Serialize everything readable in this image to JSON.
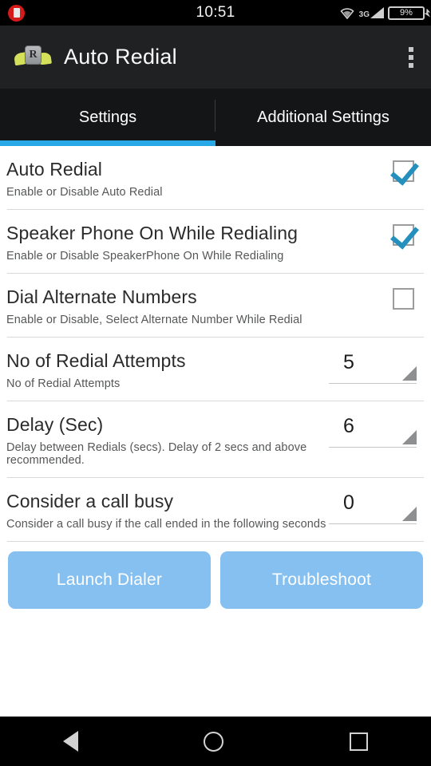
{
  "statusbar": {
    "sim_icon": "sim-card-icon",
    "clock": "10:51",
    "wifi_icon": "wifi-icon",
    "network_label": "3G",
    "signal_icon": "signal-bars-icon",
    "battery_text": "9%",
    "battery_charging_icon": "charging-bolt-icon"
  },
  "actionbar": {
    "app_icon": "auto-redial-app-icon",
    "app_icon_letter": "R",
    "title": "Auto Redial",
    "overflow_icon": "overflow-menu-icon"
  },
  "tabs": [
    {
      "label": "Settings",
      "active": true
    },
    {
      "label": "Additional Settings",
      "active": false
    }
  ],
  "settings": {
    "rows": [
      {
        "title": "Auto Redial",
        "subtitle": "Enable or Disable Auto Redial",
        "control": "checkbox",
        "checked": true
      },
      {
        "title": "Speaker Phone On While Redialing",
        "subtitle": "Enable or Disable SpeakerPhone On While Redialing",
        "control": "checkbox",
        "checked": true
      },
      {
        "title": "Dial Alternate Numbers",
        "subtitle": "Enable or Disable, Select Alternate Number While Redial",
        "control": "checkbox",
        "checked": false
      },
      {
        "title": "No of Redial Attempts",
        "subtitle": "No of Redial Attempts",
        "control": "spinner",
        "value": "5"
      },
      {
        "title": "Delay (Sec)",
        "subtitle": "Delay between Redials (secs). Delay of 2 secs and above recommended.",
        "control": "spinner",
        "value": "6"
      },
      {
        "title": "Consider a call busy",
        "subtitle": "Consider a call busy if the call ended in the following seconds",
        "control": "spinner",
        "value": "0"
      }
    ]
  },
  "buttons": {
    "launch_dialer": "Launch Dialer",
    "troubleshoot": "Troubleshoot"
  },
  "navbar": {
    "back_icon": "back-triangle-icon",
    "home_icon": "home-circle-icon",
    "recent_icon": "recent-apps-square-icon"
  },
  "colors": {
    "accent_blue": "#28a8e6",
    "button_blue": "#85c0f0",
    "checkbox_check": "#2590bd",
    "actionbar_bg": "#1f2122",
    "tabbar_bg": "#141516"
  }
}
